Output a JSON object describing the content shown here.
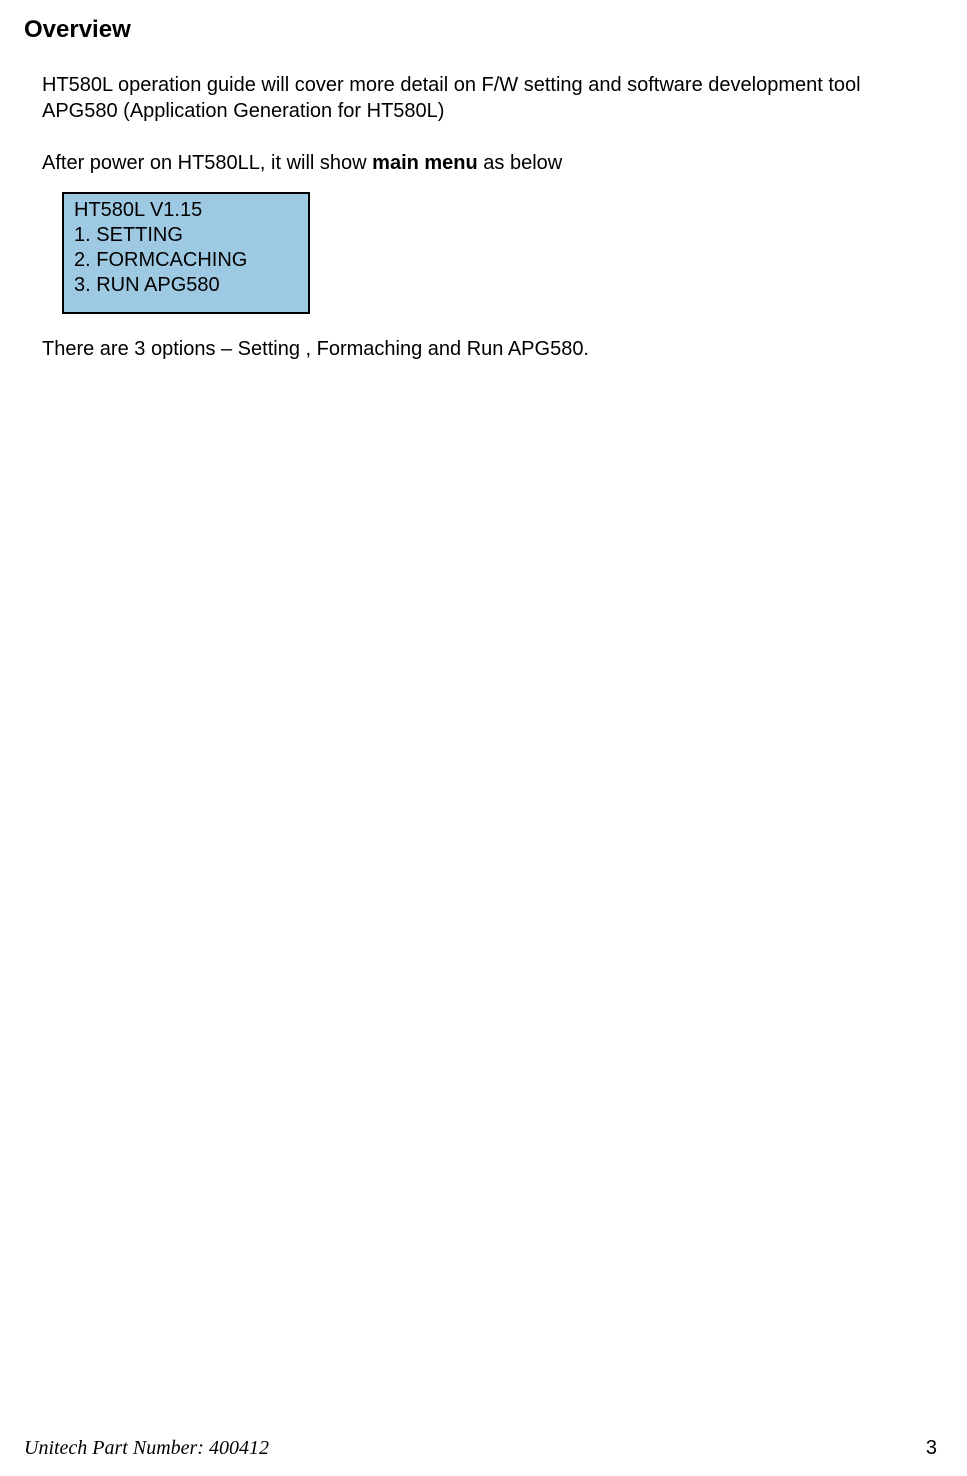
{
  "heading": "Overview",
  "intro": "HT580L operation guide will cover more detail on F/W setting and software development tool APG580 (Application Generation for HT580L)",
  "poweron_prefix": "After power on HT580LL, it will show ",
  "poweron_bold": "main menu",
  "poweron_suffix": " as below",
  "menu": {
    "title": "HT580L V1.15",
    "item1": "1. SETTING",
    "item2": "2. FORMCACHING",
    "item3": "3. RUN APG580"
  },
  "options_text": "There are 3 options – Setting , Formaching and Run APG580.",
  "footer": {
    "partnum": "Unitech Part Number: 400412",
    "pagenum": "3"
  }
}
